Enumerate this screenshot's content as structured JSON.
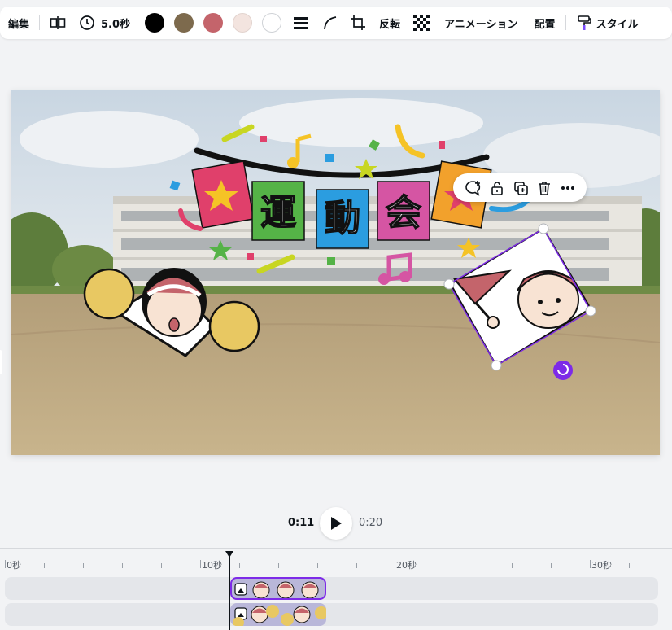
{
  "toolbar": {
    "edit_label": "編集",
    "duration_label": "5.0秒",
    "flip_label": "反転",
    "animation_label": "アニメーション",
    "position_label": "配置",
    "style_label": "スタイル",
    "swatches": [
      "#000000",
      "#7d6a4d",
      "#c4646b",
      "#f3e4df",
      "#ffffff"
    ]
  },
  "canvas": {
    "banner_chars": [
      "運",
      "動",
      "会"
    ]
  },
  "playback": {
    "current_time": "0:11",
    "total_time": "0:20"
  },
  "timeline": {
    "ticks": [
      "0秒",
      "10秒",
      "20秒",
      "30秒"
    ]
  }
}
